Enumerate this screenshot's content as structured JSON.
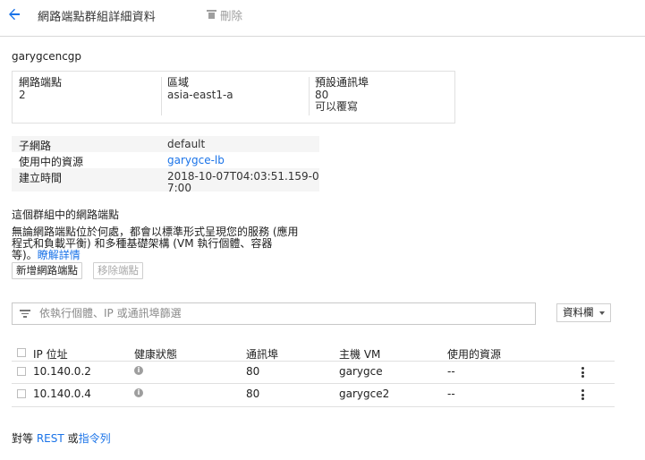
{
  "header": {
    "title": "網路端點群組詳細資料",
    "delete_label": "刪除"
  },
  "group_name": "garygcencgp",
  "summary": {
    "endpoints_label": "網路端點",
    "endpoints_value": "2",
    "zone_label": "區域",
    "zone_value": "asia-east1-a",
    "port_label": "預設通訊埠",
    "port_value": "80",
    "port_note": "可以覆寫"
  },
  "properties": {
    "subnet_label": "子網路",
    "subnet_value": "default",
    "in_use_label": "使用中的資源",
    "in_use_value": "garygce-lb",
    "created_label": "建立時間",
    "created_value": "2018-10-07T04:03:51.159-07:00"
  },
  "endpoints_section": {
    "title": "這個群組中的網路端點",
    "desc_line1": "無論網路端點位於何處，都會以標準形式呈現您的服務 (應用",
    "desc_line2": "程式和負載平衡) 和多種基礎架構 (VM 執行個體、容器",
    "desc_line3": "等)。",
    "learn_more": "瞭解詳情",
    "add_button": "新增網路端點",
    "remove_button": "移除端點"
  },
  "filter": {
    "placeholder": "依執行個體、IP 或通訊埠篩選",
    "columns_button": "資料欄"
  },
  "table": {
    "headers": [
      "IP 位址",
      "健康狀態",
      "通訊埠",
      "主機 VM",
      "使用的資源"
    ],
    "rows": [
      {
        "ip": "10.140.0.2",
        "port": "80",
        "vm": "garygce",
        "resource": "--"
      },
      {
        "ip": "10.140.0.4",
        "port": "80",
        "vm": "garygce2",
        "resource": "--"
      }
    ]
  },
  "footer": {
    "prefix": "對等",
    "rest": "REST",
    "or": "或",
    "cli": "指令列"
  },
  "colors": {
    "accent": "#1a73e8",
    "muted": "#9e9e9e"
  }
}
